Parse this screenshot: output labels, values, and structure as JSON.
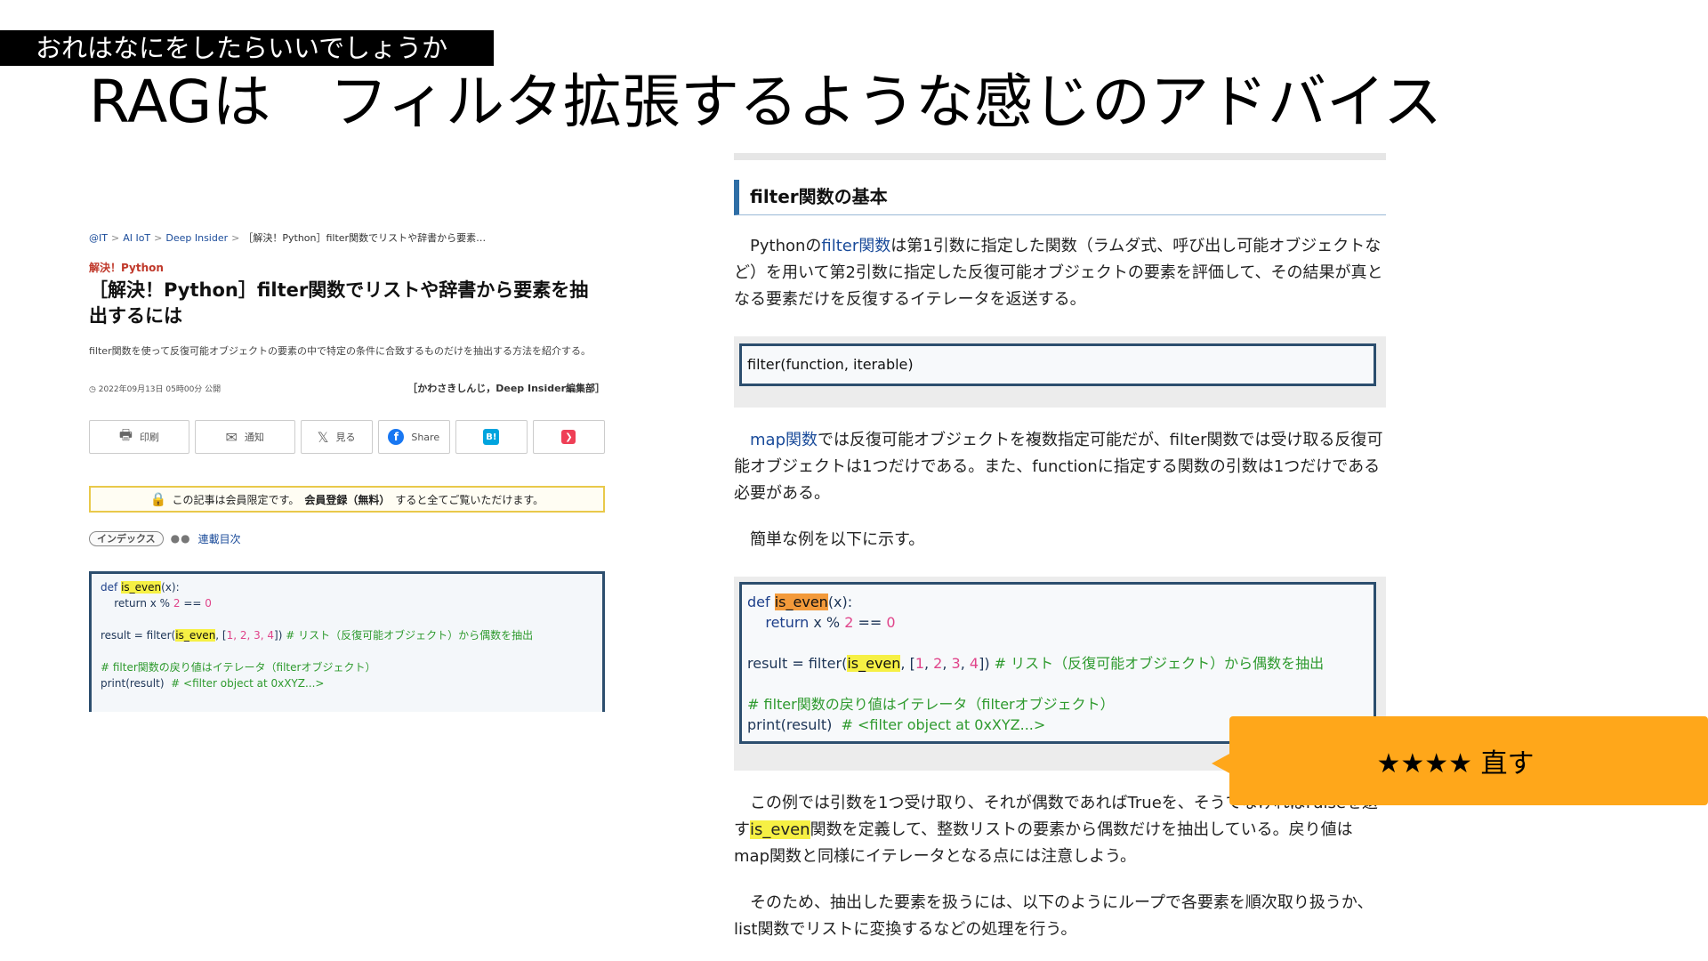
{
  "slide": {
    "tag": "おれはなにをしたらいいでしょうか",
    "title": "RAGは　フィルタ拡張するような感じのアドバイス"
  },
  "left_article": {
    "breadcrumb": [
      "@IT",
      "AI IoT",
      "Deep Insider",
      "［解決！Python］filter関数でリストや辞書から要素…"
    ],
    "category": "解決！Python",
    "title": "［解決！Python］filter関数でリストや辞書から要素を抽出するには",
    "lead": "filter関数を使って反復可能オブジェクトの要素の中で特定の条件に合致するものだけを抽出する方法を紹介する。",
    "date": "2022年09月13日 05時00分 公開",
    "author": "［かわさきしんじ，Deep Insider編集部］",
    "share": {
      "print": "印刷",
      "notify": "通知",
      "view": "見る",
      "share": "Share",
      "hatena": "B!"
    },
    "notice": {
      "pre": "この記事は会員限定です。",
      "bold": "会員登録（無料）",
      "post": "すると全てご覧いただけます。"
    },
    "index_label": "インデックス",
    "series_link": "連載目次",
    "code": {
      "l1_kw": "def",
      "l1_fn": "is_even",
      "l1_rest": "(x):",
      "l2": "    return x % ",
      "l2_num": "2",
      "l2_rest": " == ",
      "l2_num2": "0",
      "l3_pre": "result = filter(",
      "l3_fn": "is_even",
      "l3_mid": ", [",
      "l3_nums": "1, 2, 3, 4",
      "l3_end": "])",
      "l3_cm": " # リスト（反復可能オブジェクト）から偶数を抽出",
      "l4_cm": "# filter関数の戻り値はイテレータ（filterオブジェクト）",
      "l5_pre": "print(result)",
      "l5_cm": "  # <filter object at 0xXYZ...>"
    }
  },
  "right_article": {
    "section_title": "filter関数の基本",
    "p1_a": "　Pythonの",
    "p1_link": "filter関数",
    "p1_b": "は第1引数に指定した関数（ラムダ式、呼び出し可能オブジェクトなど）を用いて第2引数に指定した反復可能オブジェクトの要素を評価して、その結果が真となる要素だけを反復するイテレータを返送する。",
    "syntax": "filter(function, iterable)",
    "p2_a": "　",
    "p2_link": "map関数",
    "p2_b": "では反復可能オブジェクトを複数指定可能だが、filter関数では受け取る反復可能オブジェクトは1つだけである。また、functionに指定する関数の引数は1つだけである必要がある。",
    "p3": "　簡単な例を以下に示す。",
    "code": {
      "l1_kw": "def",
      "l1_fn": "is_even",
      "l1_rest": "(x):",
      "l2_kw": "    return",
      "l2_rest": " x % ",
      "l2_num": "2",
      "l2_eq": " == ",
      "l2_num2": "0",
      "l3_pre": "result = filter(",
      "l3_fn": "is_even",
      "l3_mid": ", [",
      "l3_n1": "1",
      "l3_n2": "2",
      "l3_n3": "3",
      "l3_n4": "4",
      "l3_end": "])",
      "l3_cm": " # リスト（反復可能オブジェクト）から偶数を抽出",
      "l4_cm": "# filter関数の戻り値はイテレータ（filterオブジェクト）",
      "l5_pre": "print(result)",
      "l5_cm": "  # <filter object at 0xXYZ...>"
    },
    "p4_a": "　この例では引数を1つ受け取り、それが偶数であればTrueを、そうでなければFalseを返す",
    "p4_hl": "is_even",
    "p4_b": "関数を定義して、整数リストの要素から偶数だけを抽出している。戻り値はmap関数と同様にイテレータとなる点には注意しよう。",
    "p5": "　そのため、抽出した要素を扱うには、以下のようにループで各要素を順次取り扱うか、list関数でリストに変換するなどの処理を行う。"
  },
  "callout": {
    "text": "★★★★ 直す",
    "color": "#ffa71a"
  }
}
